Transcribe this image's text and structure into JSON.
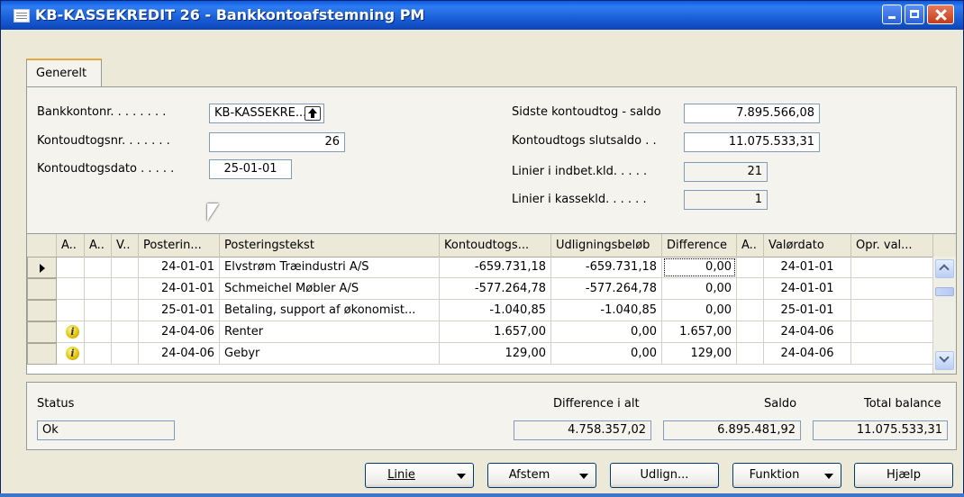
{
  "window": {
    "title": "KB-KASSEKREDIT 26 - Bankkontoafstemning PM",
    "icon": "table-icon"
  },
  "tabs": [
    {
      "label": "Generelt"
    }
  ],
  "form": {
    "bankkontonr_label": "Bankkontonr. . . . . . . .",
    "bankkontonr_value": "KB-KASSEKRE...",
    "kontoudtogsnr_label": "Kontoudtogsnr. . . . . . .",
    "kontoudtogsnr_value": "26",
    "kontoudtogsdato_label": "Kontoudtogsdato . . . . .",
    "kontoudtogsdato_value": "25-01-01",
    "sidste_saldo_label": "Sidste kontoudtog - saldo",
    "sidste_saldo_value": "7.895.566,08",
    "slutsaldo_label": "Kontoudtogs slutsaldo . .",
    "slutsaldo_value": "11.075.533,31",
    "linier_indbet_label": "Linier i indbet.kld. . . . .",
    "linier_indbet_value": "21",
    "linier_kasse_label": "Linier i kassekld. . . . . .",
    "linier_kasse_value": "1"
  },
  "grid": {
    "columns": [
      "A..",
      "A..",
      "V..",
      "Posterin...",
      "Posteringstekst",
      "Kontoudtogs...",
      "Udligningsbeløb",
      "Difference",
      "A..",
      "Valørdato",
      "Opr. val..."
    ],
    "rows": [
      {
        "current": true,
        "info": false,
        "date": "24-01-01",
        "text": "Elvstrøm Træindustri A/S",
        "kontoudtog": "-659.731,18",
        "udligning": "-659.731,18",
        "difference": "0,00",
        "valordato": "24-01-01"
      },
      {
        "current": false,
        "info": false,
        "date": "24-01-01",
        "text": "Schmeichel Møbler A/S",
        "kontoudtog": "-577.264,78",
        "udligning": "-577.264,78",
        "difference": "0,00",
        "valordato": "24-01-01"
      },
      {
        "current": false,
        "info": false,
        "date": "25-01-01",
        "text": "Betaling, support af økonomist...",
        "kontoudtog": "-1.040,85",
        "udligning": "-1.040,85",
        "difference": "0,00",
        "valordato": "25-01-01"
      },
      {
        "current": false,
        "info": true,
        "date": "24-04-06",
        "text": "Renter",
        "kontoudtog": "1.657,00",
        "udligning": "0,00",
        "difference": "1.657,00",
        "valordato": "24-04-06"
      },
      {
        "current": false,
        "info": true,
        "date": "24-04-06",
        "text": "Gebyr",
        "kontoudtog": "129,00",
        "udligning": "0,00",
        "difference": "129,00",
        "valordato": "24-04-06"
      }
    ]
  },
  "summary": {
    "status_label": "Status",
    "status_value": "Ok",
    "difference_label": "Difference i alt",
    "difference_value": "4.758.357,02",
    "saldo_label": "Saldo",
    "saldo_value": "6.895.481,92",
    "total_label": "Total balance",
    "total_value": "11.075.533,31"
  },
  "buttons": {
    "linie": "Linie",
    "afstem": "Afstem",
    "udlign": "Udlign...",
    "funktion": "Funktion",
    "hjaelp": "Hjælp"
  }
}
